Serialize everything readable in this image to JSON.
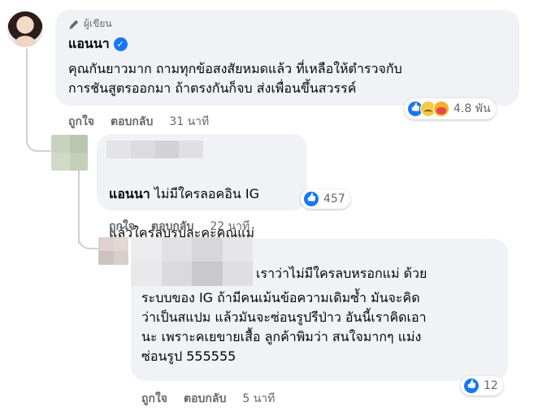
{
  "comment_main": {
    "author_badge": "ผู้เขียน",
    "name": "แอนนา",
    "text": "คุณกันยาวมาก ถามทุกข้อสงสัยหมดแล้ว ที่เหลือให้ตำรวจกับ\nการชันสูตรออกมา ถ้าตรงกันก็จบ ส่งเพื่อนขึ้นสวรรค์",
    "reactions": [
      "like",
      "sad",
      "care"
    ],
    "reaction_count": "4.8 พัน",
    "like_label": "ถูกใจ",
    "reply_label": "ตอบกลับ",
    "time": "31 นาที"
  },
  "reply_1": {
    "name": "แอนนา",
    "text_after_name": " ไม่มีใครลอคอิน IG",
    "text_line2": "แล้วใครลบรูปล่ะคะคุณแม่",
    "reactions": [
      "like"
    ],
    "reaction_count": "457",
    "like_label": "ถูกใจ",
    "reply_label": "ตอบกลับ",
    "time": "22 นาที"
  },
  "reply_2": {
    "text_line1": "เราว่าไม่มีใครลบหรอกแม่ ด้วย",
    "text_rest": "ระบบของ IG ถ้ามีคนเม้นข้อความเดิมซ้ำ มันจะคิด\nว่าเป็นสแปม แล้วมันจะซ่อนรูปรีป่าว อันนี้เราคิดเอา\nนะ เพราะคเยขายเสื้อ ลูกค้าพิมว่า สนใจมากๆ แม่ง\nซ่อนรูป 555555",
    "reactions": [
      "like"
    ],
    "reaction_count": "12",
    "like_label": "ถูกใจ",
    "reply_label": "ตอบกลับ",
    "time": "5 นาที"
  }
}
